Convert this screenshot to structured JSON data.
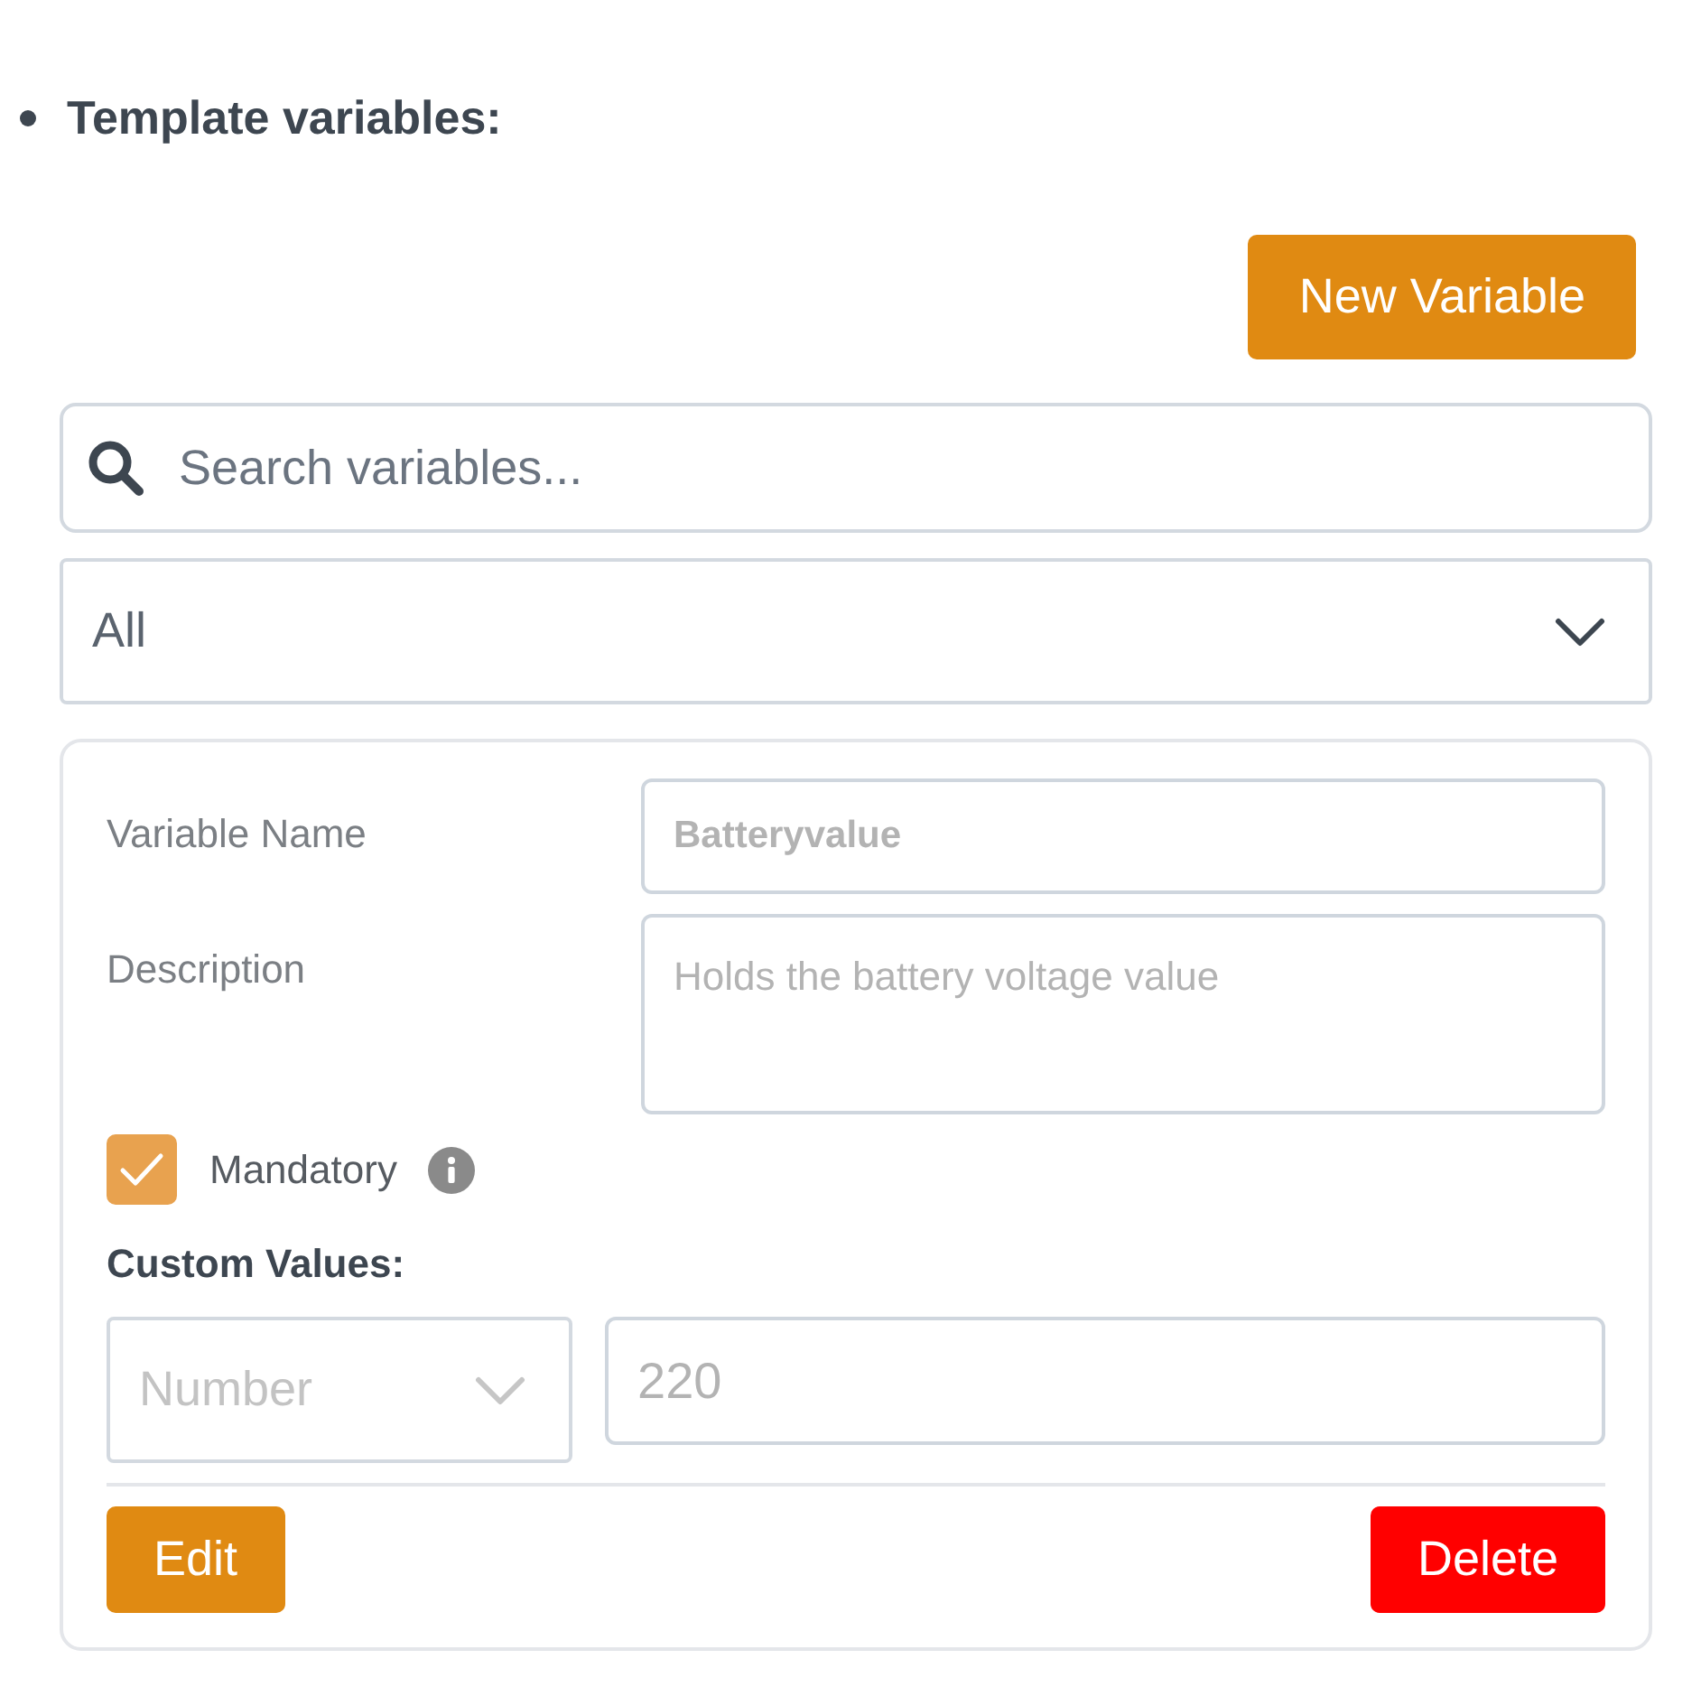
{
  "heading": {
    "text": "Template variables:"
  },
  "new_variable_button": {
    "label": "New Variable"
  },
  "search": {
    "placeholder": "Search variables..."
  },
  "filter": {
    "value": "All"
  },
  "variable_card": {
    "fields": [
      {
        "label": "Variable Name",
        "kind": "input",
        "value": "Batteryvalue",
        "disabled": true
      },
      {
        "label": "Description",
        "kind": "textarea",
        "value": "Holds the battery voltage value",
        "disabled": true
      }
    ],
    "mandatory": {
      "label": "Mandatory",
      "checked": true
    },
    "custom_values": {
      "heading": "Custom Values:",
      "type": {
        "value": "Number",
        "disabled": true
      },
      "value": {
        "value": "220",
        "disabled": true
      }
    },
    "buttons": [
      {
        "label": "Edit",
        "kind": "edit"
      },
      {
        "label": "Delete",
        "kind": "delete"
      }
    ]
  }
}
